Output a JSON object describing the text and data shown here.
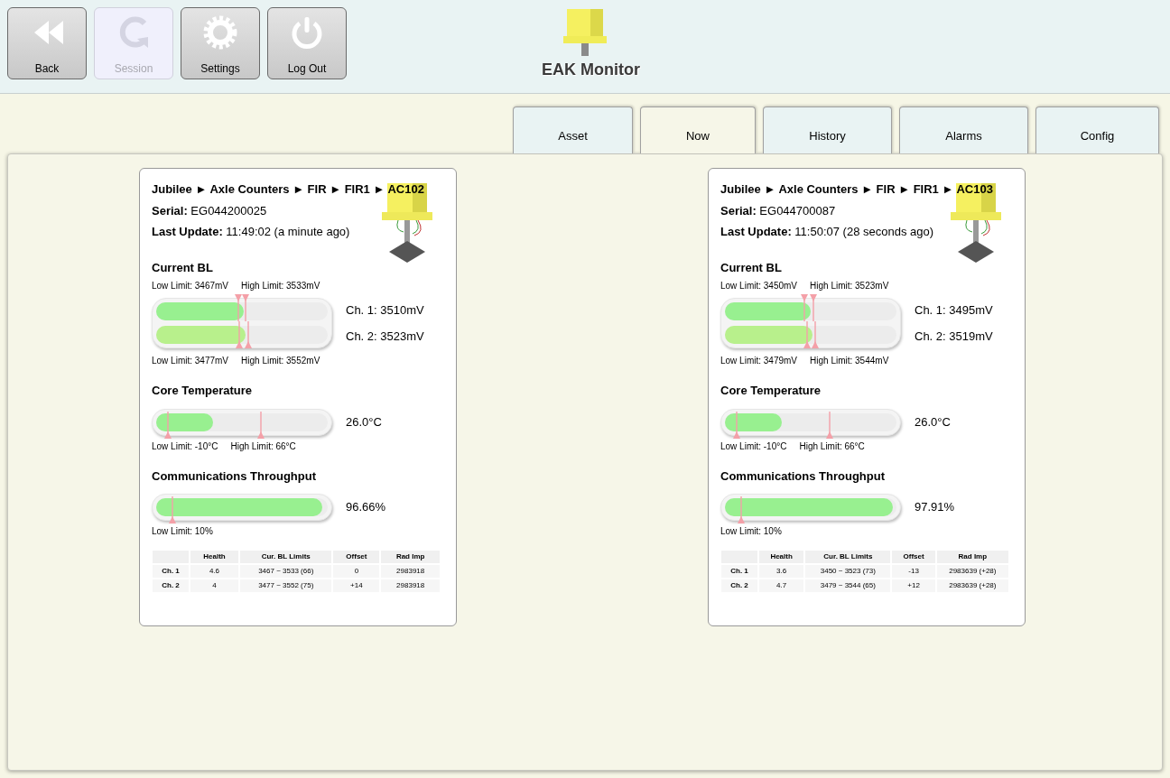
{
  "toolbar": [
    {
      "label": "Back",
      "kind": "back",
      "disabled": false
    },
    {
      "label": "Session",
      "kind": "session",
      "disabled": true
    },
    {
      "label": "Settings",
      "kind": "settings",
      "disabled": false
    },
    {
      "label": "Log Out",
      "kind": "power",
      "disabled": false
    }
  ],
  "logo": {
    "text": "EAK Monitor"
  },
  "tabs": [
    {
      "label": "Asset",
      "selected": false
    },
    {
      "label": "Now",
      "selected": true
    },
    {
      "label": "History",
      "selected": false
    },
    {
      "label": "Alarms",
      "selected": false
    },
    {
      "label": "Config",
      "selected": false
    }
  ],
  "cards": [
    {
      "path": "Jubilee ► Axle Counters ► FIR ► FIR1 ► AC102",
      "serial": "**Serial:** EG044200025",
      "last_update": "**Last Update:** 11:49:02 (a minute ago)",
      "current_bl": {
        "title": "Current BL",
        "channels": [
          {
            "limits": [
              {
                "text": "Low Limit: 3467mV",
                "level": 0.48
              },
              {
                "text": "High Limit: 3533mV",
                "level": 0.52
              }
            ],
            "level": 0.51,
            "reading": "Ch. 1: 3510mV"
          },
          {
            "limits": [
              {
                "text": "Low Limit: 3477mV",
                "level": 0.485
              },
              {
                "text": "High Limit: 3552mV",
                "level": 0.535
              }
            ],
            "level": 0.52,
            "reading": "Ch. 2: 3523mV"
          }
        ]
      },
      "temperature": {
        "title": "Core Temperature",
        "level": 0.33,
        "reading": "26.0°C",
        "limits": [
          {
            "text": "Low Limit: -10°C",
            "level": 0.07
          },
          {
            "text": "High Limit: 66°C",
            "level": 0.61
          }
        ]
      },
      "throughput": {
        "title": "Communications Throughput",
        "level": 0.97,
        "reading": "96.66%",
        "limits": [
          {
            "text": "Low Limit: 10%",
            "level": 0.095
          }
        ]
      },
      "table": {
        "columns": [
          "Health",
          "Cur. BL Limits",
          "Offset",
          "Rad Imp"
        ],
        "rows": [
          {
            "label": "Ch. 1",
            "cells": [
              "4.6",
              "3467 ~ 3533 (66)",
              "0",
              "2983918"
            ]
          },
          {
            "label": "Ch. 2",
            "cells": [
              "4",
              "3477 ~ 3552 (75)",
              "+14",
              "2983918"
            ]
          }
        ]
      }
    },
    {
      "path": "Jubilee ► Axle Counters ► FIR ► FIR1 ► AC103",
      "serial": "**Serial:** EG044700087",
      "last_update": "**Last Update:** 11:50:07 (28 seconds ago)",
      "current_bl": {
        "title": "Current BL",
        "channels": [
          {
            "limits": [
              {
                "text": "Low Limit: 3450mV",
                "level": 0.465
              },
              {
                "text": "High Limit: 3523mV",
                "level": 0.515
              }
            ],
            "level": 0.5,
            "reading": "Ch. 1: 3495mV"
          },
          {
            "limits": [
              {
                "text": "Low Limit: 3479mV",
                "level": 0.48
              },
              {
                "text": "High Limit: 3544mV",
                "level": 0.525
              }
            ],
            "level": 0.51,
            "reading": "Ch. 2: 3519mV"
          }
        ]
      },
      "temperature": {
        "title": "Core Temperature",
        "level": 0.33,
        "reading": "26.0°C",
        "limits": [
          {
            "text": "Low Limit: -10°C",
            "level": 0.07
          },
          {
            "text": "High Limit: 66°C",
            "level": 0.61
          }
        ]
      },
      "throughput": {
        "title": "Communications Throughput",
        "level": 0.98,
        "reading": "97.91%",
        "limits": [
          {
            "text": "Low Limit: 10%",
            "level": 0.095
          }
        ]
      },
      "table": {
        "columns": [
          "Health",
          "Cur. BL Limits",
          "Offset",
          "Rad Imp"
        ],
        "rows": [
          {
            "label": "Ch. 1",
            "cells": [
              "3.6",
              "3450 ~ 3523 (73)",
              "-13",
              "2983639 (+28)"
            ]
          },
          {
            "label": "Ch. 2",
            "cells": [
              "4.7",
              "3479 ~ 3544 (65)",
              "+12",
              "2983639 (+28)"
            ]
          }
        ]
      }
    }
  ]
}
